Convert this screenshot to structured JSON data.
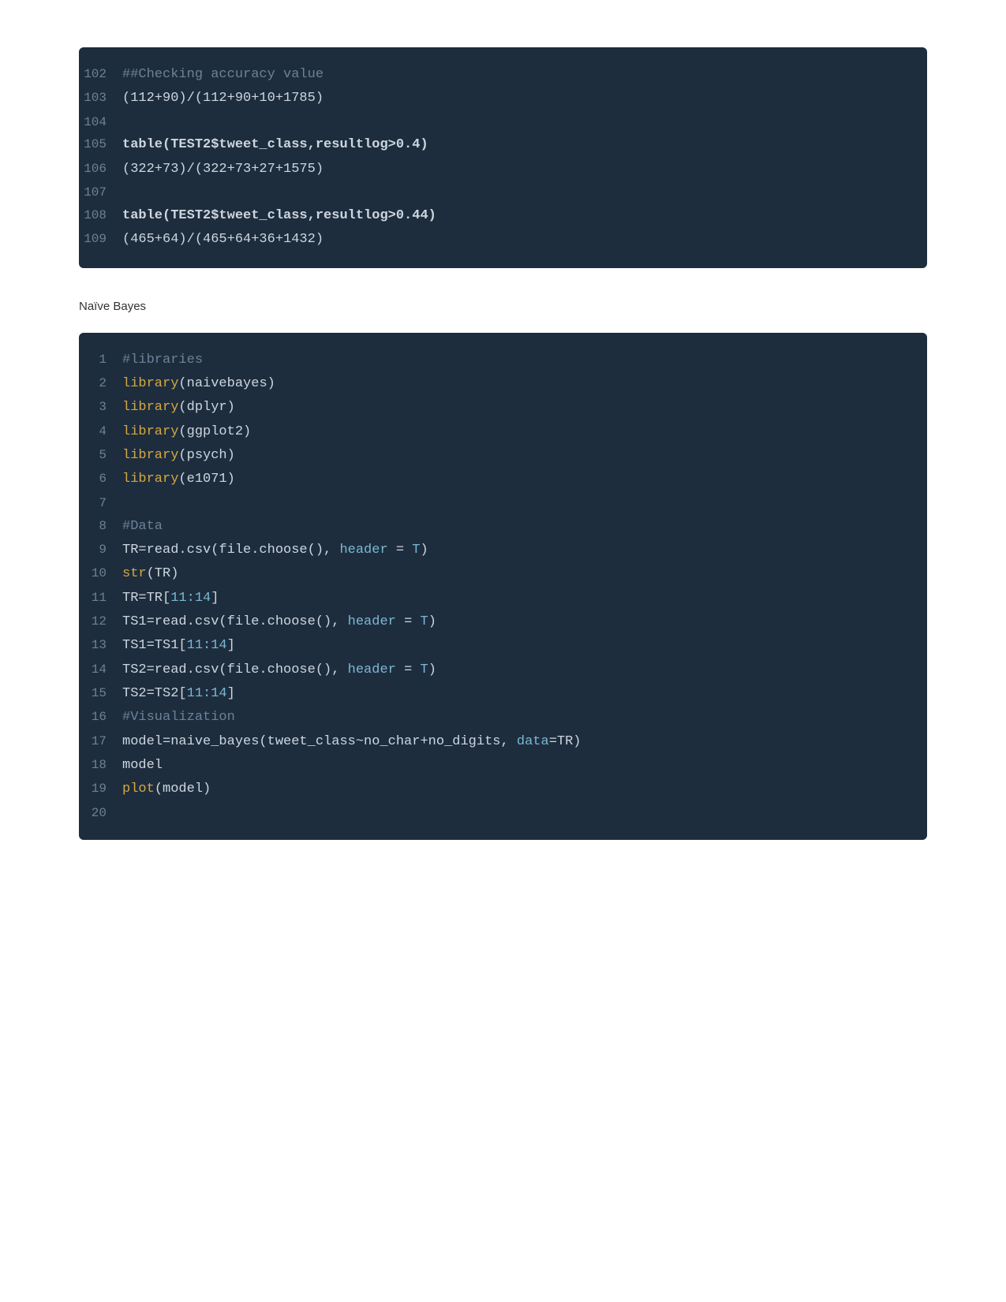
{
  "section1": {
    "lines": [
      {
        "num": "102",
        "content": "##Checking accuracy value",
        "type": "comment"
      },
      {
        "num": "103",
        "content": "(112+90)/(112+90+10+1785)",
        "type": "code"
      },
      {
        "num": "104",
        "content": "",
        "type": "empty"
      },
      {
        "num": "105",
        "content": "table(TEST2$tweet_class,resultlog>0.4)",
        "type": "bold"
      },
      {
        "num": "106",
        "content": "(322+73)/(322+73+27+1575)",
        "type": "code"
      },
      {
        "num": "107",
        "content": "",
        "type": "empty"
      },
      {
        "num": "108",
        "content": "table(TEST2$tweet_class,resultlog>0.44)",
        "type": "bold"
      },
      {
        "num": "109",
        "content": "(465+64)/(465+64+36+1432)",
        "type": "code"
      }
    ]
  },
  "section_label": "Naïve Bayes",
  "section2": {
    "lines": [
      {
        "num": "1",
        "content": "#libraries",
        "type": "comment"
      },
      {
        "num": "2",
        "content": "library(naivebayes)",
        "type": "func"
      },
      {
        "num": "3",
        "content": "library(dplyr)",
        "type": "func"
      },
      {
        "num": "4",
        "content": "library(ggplot2)",
        "type": "func"
      },
      {
        "num": "5",
        "content": "library(psych)",
        "type": "func"
      },
      {
        "num": "6",
        "content": "library(e1071)",
        "type": "func"
      },
      {
        "num": "7",
        "content": "",
        "type": "empty"
      },
      {
        "num": "8",
        "content": "#Data",
        "type": "comment"
      },
      {
        "num": "9",
        "content": "TR=read.csv(file.choose(), header = T)",
        "type": "mixed_header"
      },
      {
        "num": "10",
        "content": "str(TR)",
        "type": "func"
      },
      {
        "num": "11",
        "content": "TR=TR[11:14]",
        "type": "mixed_bracket"
      },
      {
        "num": "12",
        "content": "TS1=read.csv(file.choose(), header = T)",
        "type": "mixed_header"
      },
      {
        "num": "13",
        "content": "TS1=TS1[11:14]",
        "type": "mixed_bracket"
      },
      {
        "num": "14",
        "content": "TS2=read.csv(file.choose(), header = T)",
        "type": "mixed_header"
      },
      {
        "num": "15",
        "content": "TS2=TS2[11:14]",
        "type": "mixed_bracket"
      },
      {
        "num": "16",
        "content": "#Visualization",
        "type": "comment"
      },
      {
        "num": "17",
        "content": "model=naive_bayes(tweet_class~no_char+no_digits, data=TR)",
        "type": "mixed_data"
      },
      {
        "num": "18",
        "content": "model",
        "type": "code"
      },
      {
        "num": "19",
        "content": "plot(model)",
        "type": "func"
      },
      {
        "num": "20",
        "content": "",
        "type": "empty_cut"
      }
    ]
  }
}
